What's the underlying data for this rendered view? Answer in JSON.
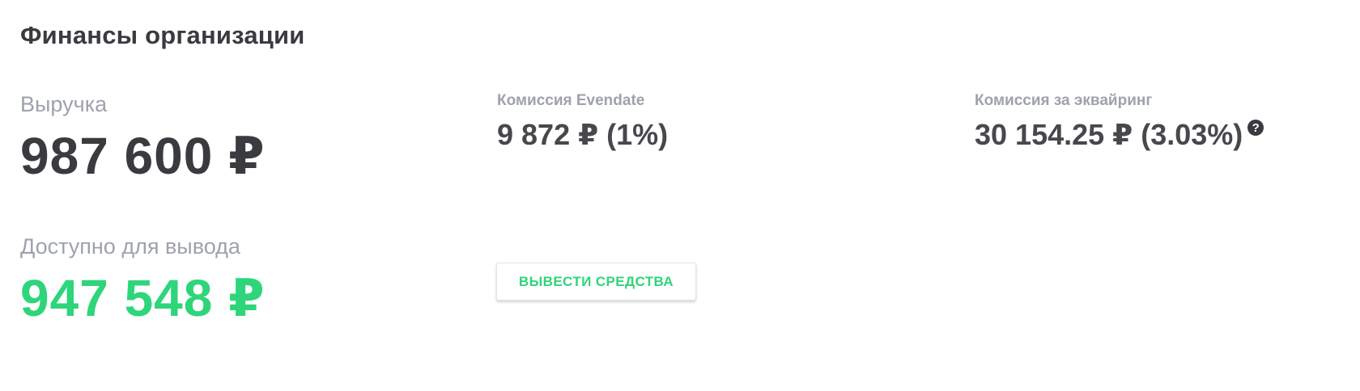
{
  "header": {
    "title": "Финансы организации"
  },
  "revenue": {
    "label": "Выручка",
    "value": "987 600 ₽"
  },
  "available": {
    "label": "Доступно для вывода",
    "value": "947 548 ₽"
  },
  "evendate_commission": {
    "label": "Комиссия Evendate",
    "value": "9 872 ₽ (1%)"
  },
  "acquiring_commission": {
    "label": "Комиссия за эквайринг",
    "value": "30 154.25 ₽ (3.03%)",
    "help_icon": "question-circle-icon",
    "help_glyph": "?"
  },
  "actions": {
    "withdraw_label": "ВЫВЕСТИ СРЕДСТВА"
  },
  "colors": {
    "text_dark": "#3a3b3f",
    "text_muted": "#9ea2ad",
    "accent_green": "#2ed57a"
  }
}
